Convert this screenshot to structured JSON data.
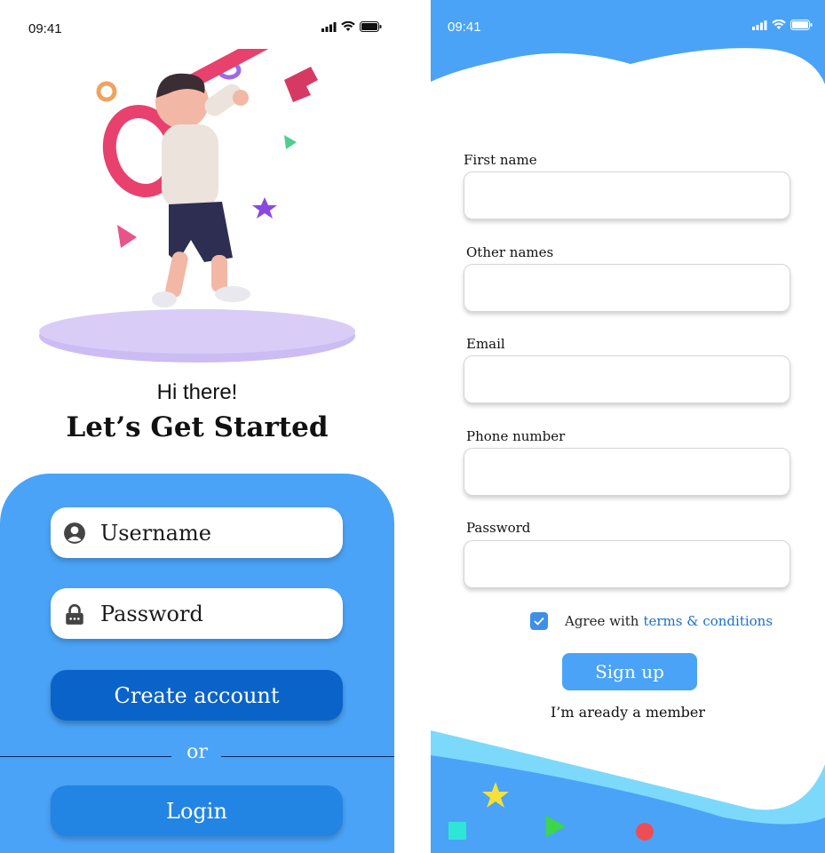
{
  "left_screen": {
    "status_time": "09:41",
    "greeting": "Hi there!",
    "headline": "Let’s Get Started",
    "username_field": {
      "label": "Username"
    },
    "password_field": {
      "label": "Password"
    },
    "create_account_label": "Create account",
    "divider_text": "or",
    "login_label": "Login"
  },
  "right_screen": {
    "status_time": "09:41",
    "fields": [
      {
        "label": "First name",
        "value": ""
      },
      {
        "label": "Other names",
        "value": ""
      },
      {
        "label": "Email",
        "value": ""
      },
      {
        "label": "Phone number",
        "value": ""
      },
      {
        "label": "Password",
        "value": ""
      }
    ],
    "agree_checked": true,
    "agree_text": "Agree with",
    "terms_link": "terms & conditions",
    "signup_label": "Sign up",
    "member_link": "I’m aready a member"
  },
  "colors": {
    "primary_blue": "#4aa3f7",
    "dark_blue": "#0a63c9",
    "light_cyan": "#7dd9fb",
    "key_pink": "#e8416e",
    "platform_lavender": "#cbbcf3"
  },
  "icons": [
    "signal-icon",
    "wifi-icon",
    "battery-icon",
    "user-icon",
    "lock-icon",
    "check-icon"
  ]
}
